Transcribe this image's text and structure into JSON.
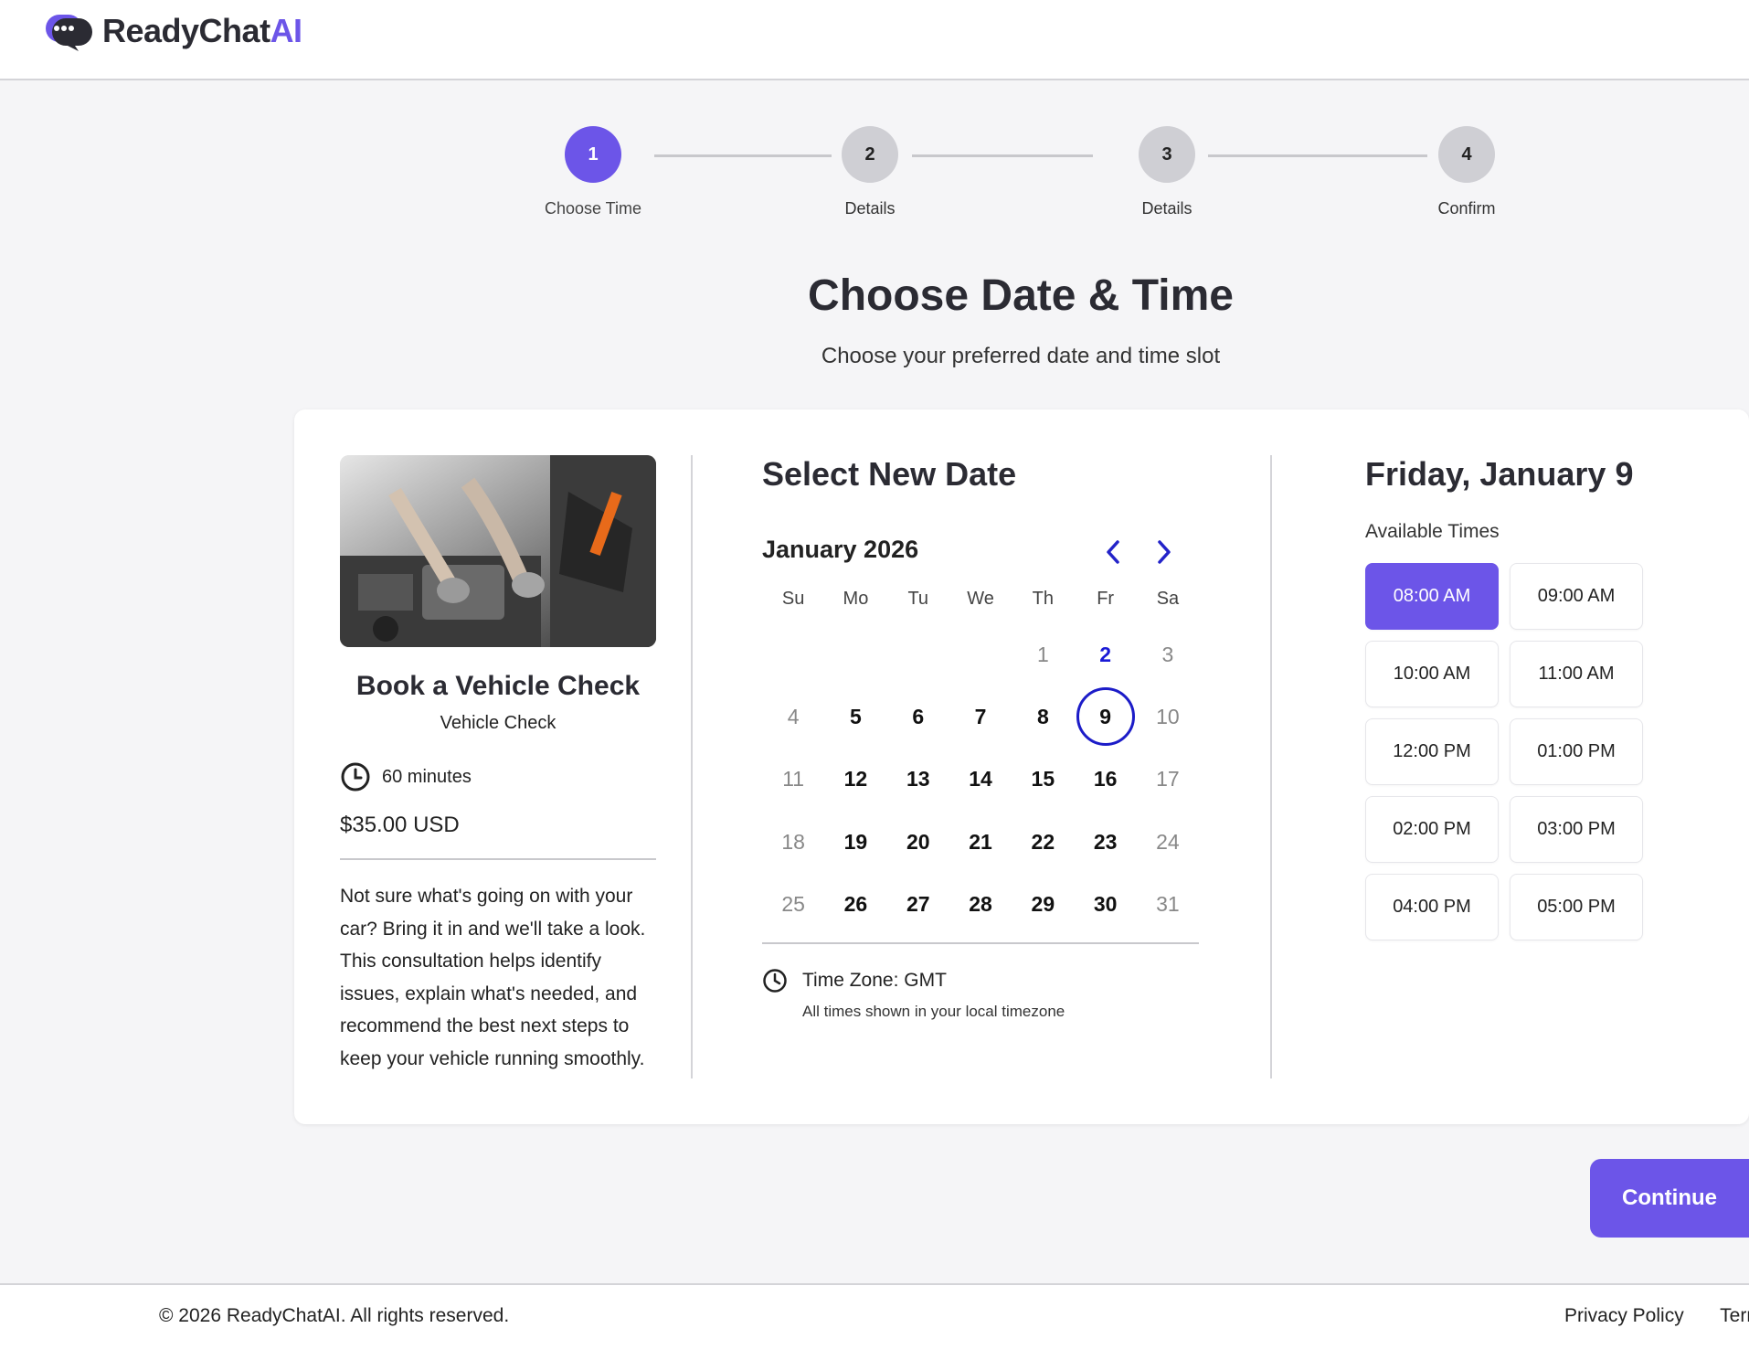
{
  "brand": {
    "name_main": "ReadyChat",
    "name_accent": "AI",
    "accent_color": "#6c55e8"
  },
  "stepper": {
    "steps": [
      {
        "number": "1",
        "label": "Choose Time",
        "active": true
      },
      {
        "number": "2",
        "label": "Details",
        "active": false
      },
      {
        "number": "3",
        "label": "Details",
        "active": false
      },
      {
        "number": "4",
        "label": "Confirm",
        "active": false
      }
    ]
  },
  "page": {
    "title": "Choose Date & Time",
    "subtitle": "Choose your preferred date and time slot"
  },
  "service": {
    "image_alt": "mechanic working on car engine",
    "title": "Book a Vehicle Check",
    "subtitle": "Vehicle Check",
    "duration": "60 minutes",
    "price": "$35.00 USD",
    "description": "Not sure what's going on with your car? Bring it in and we'll take a look. This consultation helps identify issues, explain what's needed, and recommend the best next steps to keep your vehicle running smoothly."
  },
  "calendar": {
    "section_title": "Select New Date",
    "month_label": "January 2026",
    "prev_icon": "chevron-left-icon",
    "next_icon": "chevron-right-icon",
    "weekdays": [
      "Su",
      "Mo",
      "Tu",
      "We",
      "Th",
      "Fr",
      "Sa"
    ],
    "weeks": [
      [
        "",
        "",
        "",
        "",
        "1",
        "2",
        "3"
      ],
      [
        "4",
        "5",
        "6",
        "7",
        "8",
        "9",
        "10"
      ],
      [
        "11",
        "12",
        "13",
        "14",
        "15",
        "16",
        "17"
      ],
      [
        "18",
        "19",
        "20",
        "21",
        "22",
        "23",
        "24"
      ],
      [
        "25",
        "26",
        "27",
        "28",
        "29",
        "30",
        "31"
      ]
    ],
    "available_days": [
      "5",
      "6",
      "7",
      "8",
      "9",
      "12",
      "13",
      "14",
      "15",
      "16",
      "19",
      "20",
      "21",
      "22",
      "23",
      "26",
      "27",
      "28",
      "29",
      "30"
    ],
    "today": "2",
    "selected": "9",
    "timezone_label": "Time Zone: GMT",
    "timezone_note": "All times shown in your local timezone"
  },
  "times": {
    "day_title": "Friday, January 9",
    "label": "Available Times",
    "slots": [
      "08:00 AM",
      "09:00 AM",
      "10:00 AM",
      "11:00 AM",
      "12:00 PM",
      "01:00 PM",
      "02:00 PM",
      "03:00 PM",
      "04:00 PM",
      "05:00 PM"
    ],
    "selected": "08:00 AM"
  },
  "actions": {
    "continue_label": "Continue"
  },
  "footer": {
    "copyright": "© 2026 ReadyChatAI. All rights reserved.",
    "privacy": "Privacy Policy",
    "terms": "Terr"
  }
}
